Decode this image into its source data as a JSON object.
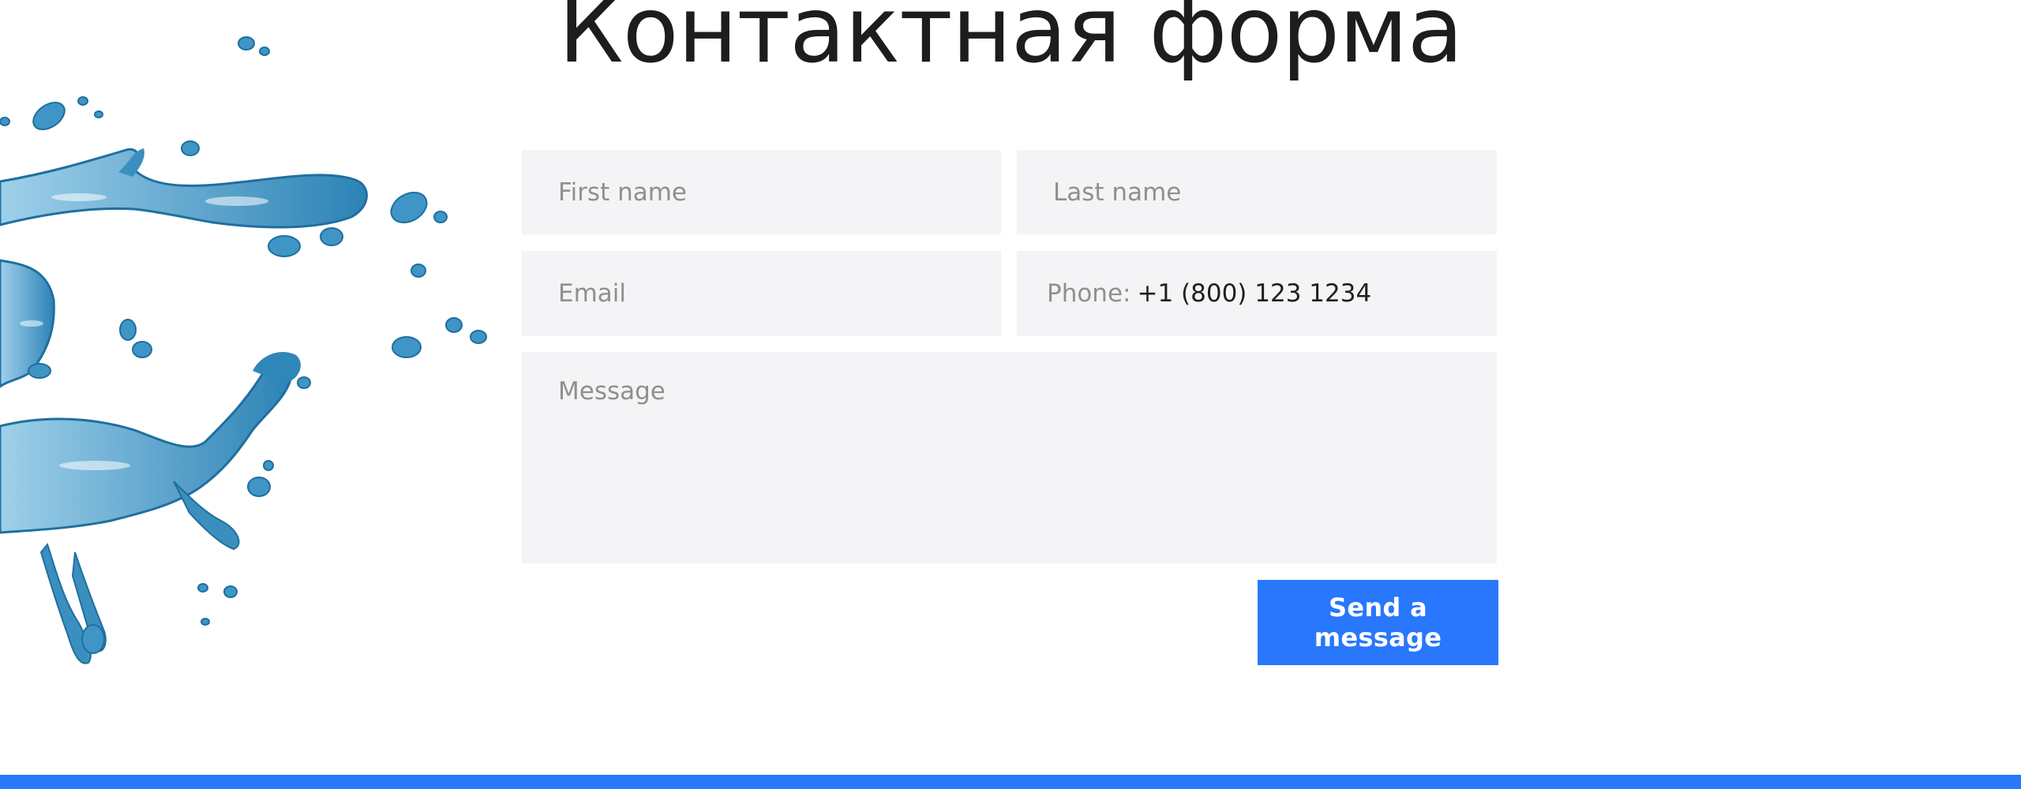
{
  "title": "Контактная форма",
  "form": {
    "first_name": {
      "placeholder": "First name"
    },
    "last_name": {
      "placeholder": "Last name"
    },
    "email": {
      "placeholder": "Email"
    },
    "phone": {
      "label": "Phone:",
      "value": "+1 (800) 123 1234"
    },
    "message": {
      "placeholder": "Message"
    },
    "submit_label": "Send a message"
  },
  "colors": {
    "accent": "#2877fd",
    "field_bg": "#f4f4f6",
    "placeholder": "#8f8f8f",
    "title": "#1d1d1d",
    "splash": "#2f86b8"
  }
}
